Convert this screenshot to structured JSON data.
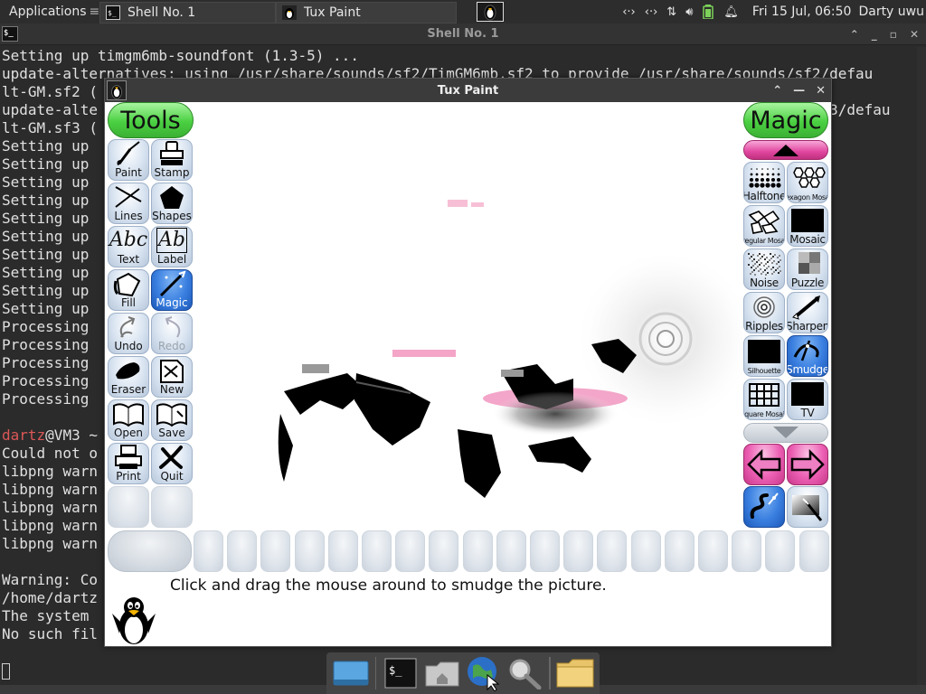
{
  "top_panel": {
    "apps_label": "Applications",
    "tasks": [
      {
        "label": "Shell No. 1"
      },
      {
        "label": "Tux Paint"
      }
    ],
    "clock": "Fri 15 Jul, 06:50",
    "user": "Darty uwu"
  },
  "terminal": {
    "title": "Shell No. 1",
    "lines": [
      "Setting up timgm6mb-soundfont (1.3-5) ...",
      "update-alternatives: using /usr/share/sounds/sf2/TimGM6mb.sf2 to provide /usr/share/sounds/sf2/defau",
      "lt-GM.sf2 (",
      "update-alte                                                                                   f3/defau",
      "lt-GM.sf3 (",
      "Setting up",
      "Setting up",
      "Setting up",
      "Setting up",
      "Setting up",
      "Setting up",
      "Setting up",
      "Setting up",
      "Setting up",
      "Setting up",
      "Processing",
      "Processing",
      "Processing",
      "Processing",
      "Processing",
      "",
      "dartz@VM3 ~",
      "Could not o",
      "libpng warn",
      "libpng warn",
      "libpng warn",
      "libpng warn",
      "libpng warn",
      "",
      "Warning: Co",
      "/home/dartz",
      "The system",
      "No such fil"
    ]
  },
  "tux_paint": {
    "title": "Tux Paint",
    "tools_title": "Tools",
    "magic_title": "Magic",
    "tools": [
      {
        "label": "Paint",
        "icon": "paintbrush-icon"
      },
      {
        "label": "Stamp",
        "icon": "stamp-icon"
      },
      {
        "label": "Lines",
        "icon": "lines-icon"
      },
      {
        "label": "Shapes",
        "icon": "pentagon-icon"
      },
      {
        "label": "Text",
        "icon": "text-abc-icon"
      },
      {
        "label": "Label",
        "icon": "label-abc-icon"
      },
      {
        "label": "Fill",
        "icon": "paint-bucket-icon"
      },
      {
        "label": "Magic",
        "icon": "magic-wand-icon"
      },
      {
        "label": "Undo",
        "icon": "undo-icon"
      },
      {
        "label": "Redo",
        "icon": "redo-icon"
      },
      {
        "label": "Eraser",
        "icon": "eraser-icon"
      },
      {
        "label": "New",
        "icon": "new-page-icon"
      },
      {
        "label": "Open",
        "icon": "open-book-icon"
      },
      {
        "label": "Save",
        "icon": "save-book-icon"
      },
      {
        "label": "Print",
        "icon": "printer-icon"
      },
      {
        "label": "Quit",
        "icon": "quit-x-icon"
      }
    ],
    "magic_tools": [
      {
        "label": "Halftone",
        "icon": "halftone-icon"
      },
      {
        "label": "Hexagon Mosaic",
        "icon": "hexagon-mosaic-icon"
      },
      {
        "label": "Irregular Mosaic",
        "icon": "irregular-mosaic-icon"
      },
      {
        "label": "Mosaic",
        "icon": "mosaic-icon"
      },
      {
        "label": "Noise",
        "icon": "noise-icon"
      },
      {
        "label": "Puzzle",
        "icon": "puzzle-icon"
      },
      {
        "label": "Ripples",
        "icon": "ripples-icon"
      },
      {
        "label": "Sharpen",
        "icon": "sharpen-icon"
      },
      {
        "label": "Silhouette",
        "icon": "silhouette-icon"
      },
      {
        "label": "Smudge",
        "icon": "smudge-icon"
      },
      {
        "label": "Square Mosaic",
        "icon": "square-mosaic-icon"
      },
      {
        "label": "TV",
        "icon": "tv-icon"
      }
    ],
    "help_text": "Click and drag the mouse around to smudge the picture.",
    "colors": {
      "green_title": "#4bd042",
      "pink_accent": "#e0469f",
      "selected_blue": "#3a7fe0"
    }
  }
}
